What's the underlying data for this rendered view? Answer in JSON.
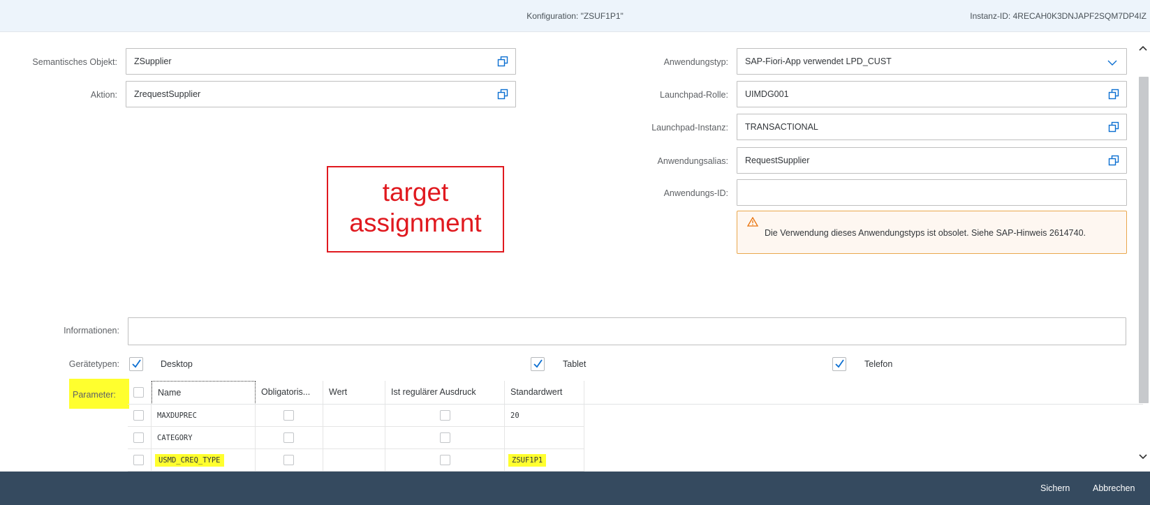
{
  "header": {
    "configuration": "Konfiguration: \"ZSUF1P1\"",
    "instance_id": "Instanz-ID: 4RECAH0K3DNJAPF2SQM7DP4IZ"
  },
  "form_left": {
    "semantic_object_label": "Semantisches Objekt:",
    "semantic_object_value": "ZSupplier",
    "action_label": "Aktion:",
    "action_value": "ZrequestSupplier"
  },
  "form_right": {
    "app_type_label": "Anwendungstyp:",
    "app_type_value": "SAP-Fiori-App verwendet LPD_CUST",
    "launchpad_role_label": "Launchpad-Rolle:",
    "launchpad_role_value": "UIMDG001",
    "launchpad_instance_label": "Launchpad-Instanz:",
    "launchpad_instance_value": "TRANSACTIONAL",
    "app_alias_label": "Anwendungsalias:",
    "app_alias_value": "RequestSupplier",
    "app_id_label": "Anwendungs-ID:",
    "app_id_value": ""
  },
  "warning": {
    "text": "Die Verwendung dieses Anwendungstyps ist obsolet. Siehe SAP-Hinweis 2614740."
  },
  "annotation": {
    "line1": "target",
    "line2": "assignment"
  },
  "information": {
    "label": "Informationen:",
    "value": ""
  },
  "device_types": {
    "label": "Gerätetypen:",
    "desktop": "Desktop",
    "tablet": "Tablet",
    "phone": "Telefon",
    "desktop_checked": true,
    "tablet_checked": true,
    "phone_checked": true
  },
  "parameters": {
    "label": "Parameter:",
    "columns": [
      "Name",
      "Obligatoris...",
      "Wert",
      "Ist regulärer Ausdruck",
      "Standardwert"
    ],
    "rows": [
      {
        "name": "MAXDUPREC",
        "mandatory": false,
        "value": "",
        "regex": false,
        "default": "20",
        "highlighted": false
      },
      {
        "name": "CATEGORY",
        "mandatory": false,
        "value": "",
        "regex": false,
        "default": "",
        "highlighted": false
      },
      {
        "name": "USMD_CREQ_TYPE",
        "mandatory": false,
        "value": "",
        "regex": false,
        "default": "ZSUF1P1",
        "highlighted": true
      }
    ]
  },
  "footer": {
    "save": "Sichern",
    "cancel": "Abbrechen"
  },
  "colors": {
    "accent": "#0a6ed1",
    "highlight": "#ffff2e",
    "annotation": "#e0191f",
    "footer_bg": "#354a5f",
    "warning_border": "#e9a74d"
  }
}
